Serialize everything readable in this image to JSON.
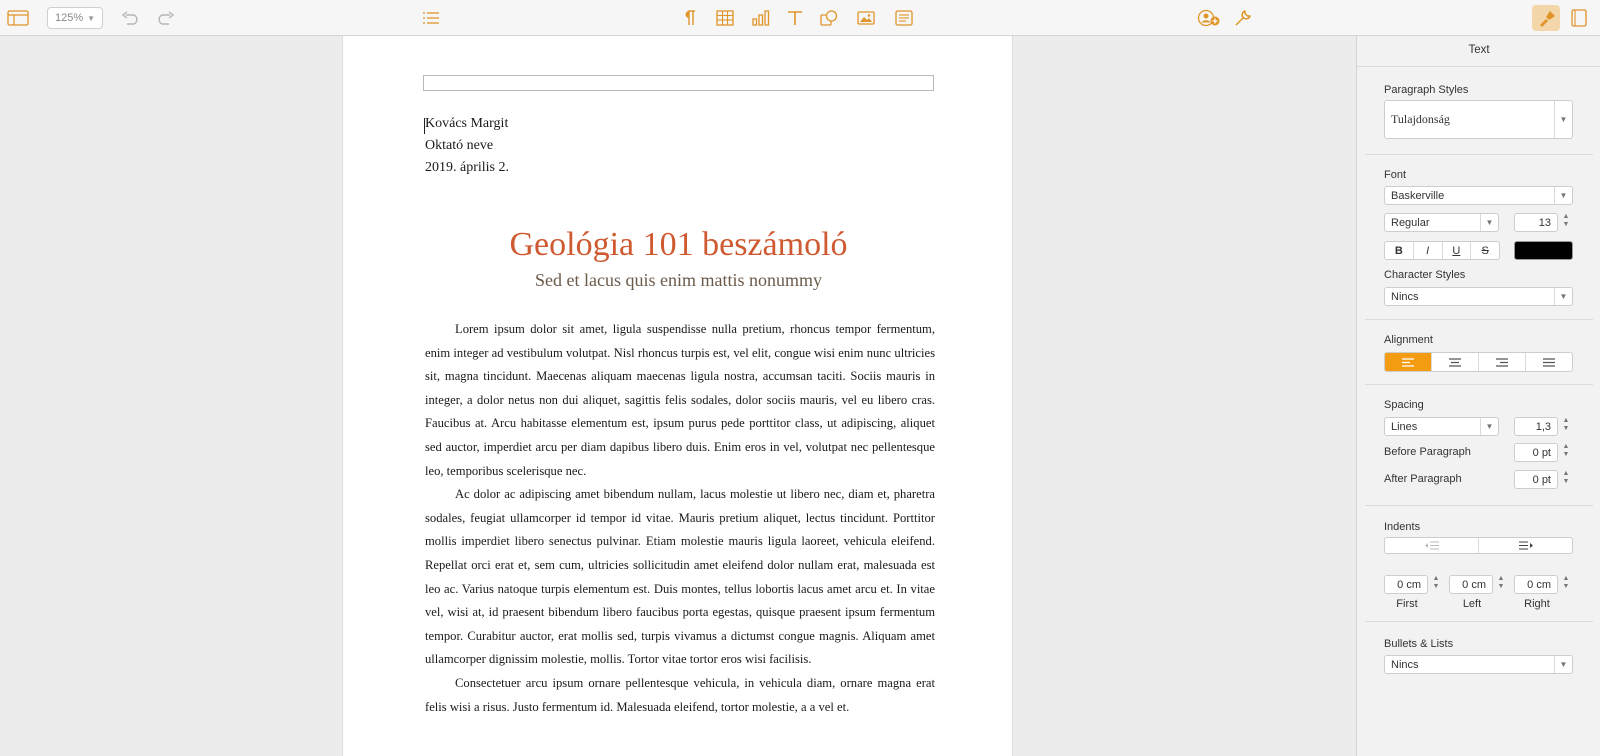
{
  "toolbar": {
    "zoom": "125%",
    "icons": [
      "view-icon",
      "undo-icon",
      "redo-icon",
      "insert-icon",
      "pilcrow-icon",
      "table-icon",
      "chart-icon",
      "text-icon",
      "shape-icon",
      "media-icon",
      "comment-icon",
      "collaborate-icon",
      "wrench-icon",
      "format-brush-icon",
      "document-icon"
    ]
  },
  "document": {
    "author": "Kovács Margit",
    "instructor": "Oktató neve",
    "date": "2019. április 2.",
    "title": "Geológia 101 beszámoló",
    "subtitle": "Sed et lacus quis enim mattis nonummy",
    "paragraphs": [
      "Lorem ipsum dolor sit amet, ligula suspendisse nulla pretium, rhoncus tempor fermentum, enim integer ad vestibulum volutpat. Nisl rhoncus turpis est, vel elit, congue wisi enim nunc ultricies sit, magna tincidunt. Maecenas aliquam maecenas ligula nostra, accumsan taciti. Sociis mauris in integer, a dolor netus non dui aliquet, sagittis felis sodales, dolor sociis mauris, vel eu libero cras. Faucibus at. Arcu habitasse elementum est, ipsum purus pede porttitor class, ut adipiscing, aliquet sed auctor, imperdiet arcu per diam dapibus libero duis. Enim eros in vel, volutpat nec pellentesque leo, temporibus scelerisque nec.",
      "Ac dolor ac adipiscing amet bibendum nullam, lacus molestie ut libero nec, diam et, pharetra sodales, feugiat ullamcorper id tempor id vitae. Mauris pretium aliquet, lectus tincidunt. Porttitor mollis imperdiet libero senectus pulvinar. Etiam molestie mauris ligula laoreet, vehicula eleifend. Repellat orci erat et, sem cum, ultricies sollicitudin amet eleifend dolor nullam erat, malesuada est leo ac. Varius natoque turpis elementum est. Duis montes, tellus lobortis lacus amet arcu et. In vitae vel, wisi at, id praesent bibendum libero faucibus porta egestas, quisque praesent ipsum fermentum tempor. Curabitur auctor, erat mollis sed, turpis vivamus a dictumst congue magnis. Aliquam amet ullamcorper dignissim molestie, mollis. Tortor vitae tortor eros wisi facilisis.",
      "Consectetuer arcu ipsum ornare pellentesque vehicula, in vehicula diam, ornare magna erat felis wisi a risus. Justo fermentum id. Malesuada eleifend, tortor molestie, a a vel et."
    ]
  },
  "inspector": {
    "title": "Text",
    "paragraph_styles_label": "Paragraph Styles",
    "paragraph_style": "Tulajdonság",
    "font_label": "Font",
    "font_family": "Baskerville",
    "font_weight": "Regular",
    "font_size": "13",
    "bold": "B",
    "italic": "I",
    "underline": "U",
    "strike": "S",
    "text_color": "#000000",
    "character_styles_label": "Character Styles",
    "character_style": "Nincs",
    "alignment_label": "Alignment",
    "spacing_label": "Spacing",
    "spacing_mode": "Lines",
    "spacing_value": "1,3",
    "before_paragraph_label": "Before Paragraph",
    "before_paragraph": "0 pt",
    "after_paragraph_label": "After Paragraph",
    "after_paragraph": "0 pt",
    "indents_label": "Indents",
    "indent_first": "0 cm",
    "indent_left": "0 cm",
    "indent_right": "0 cm",
    "first_label": "First",
    "left_label": "Left",
    "right_label": "Right",
    "bullets_label": "Bullets & Lists",
    "bullets_value": "Nincs",
    "accent": "#f39c12"
  }
}
